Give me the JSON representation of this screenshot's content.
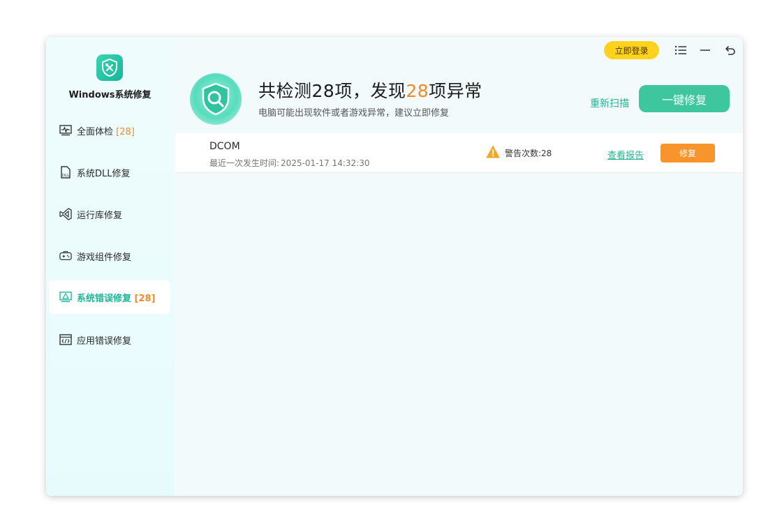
{
  "app": {
    "name": "Windows系统修复",
    "login_label": "立即登录"
  },
  "sidebar": {
    "items": [
      {
        "label": "全面体检",
        "count": "[28]",
        "icon": "pulse-monitor-icon"
      },
      {
        "label": "系统DLL修复",
        "count": "",
        "icon": "dll-file-icon"
      },
      {
        "label": "运行库修复",
        "count": "",
        "icon": "visual-studio-icon"
      },
      {
        "label": "游戏组件修复",
        "count": "",
        "icon": "gamepad-icon"
      },
      {
        "label": "系统错误修复",
        "count": "[28]",
        "icon": "warning-monitor-icon",
        "active": true
      },
      {
        "label": "应用错误修复",
        "count": "",
        "icon": "code-window-icon"
      }
    ]
  },
  "summary": {
    "prefix": "共检测",
    "total": "28",
    "middle": "项，发现",
    "found": "28",
    "suffix": "项异常",
    "subtitle": "电脑可能出现软件或者游戏异常，建议立即修复",
    "rescan_label": "重新扫描",
    "fix_all_label": "一键修复"
  },
  "issues": [
    {
      "name": "DCOM",
      "time_label": "最近一次发生时间:",
      "time": "2025-01-17 14:32:30",
      "warn_label": "警告次数:",
      "warn_count": "28",
      "report_label": "查看报告",
      "fix_label": "修复"
    }
  ],
  "colors": {
    "accent": "#23b493",
    "orange": "#f08a2a",
    "login_yellow": "#ffd21e",
    "fix_button": "#f7952c",
    "primary_button": "#3ec79f"
  }
}
